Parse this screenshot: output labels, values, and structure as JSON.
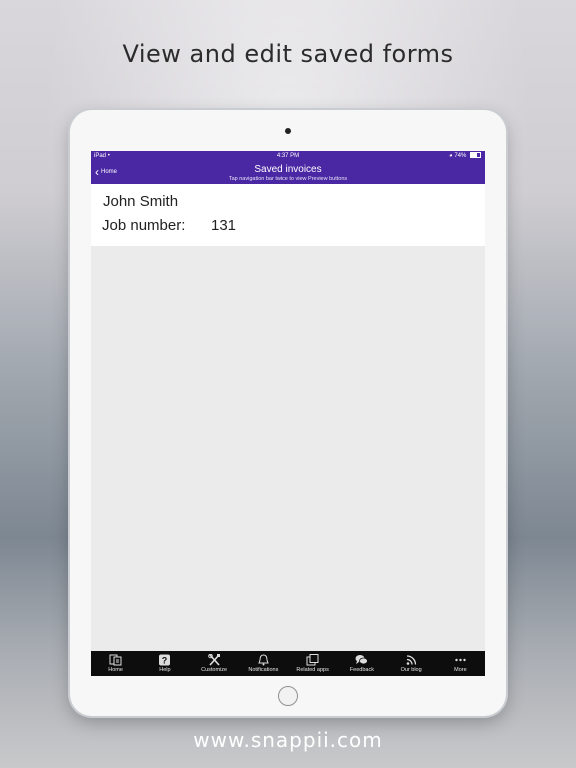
{
  "headline": "View and edit saved forms",
  "footer_url": "www.snappii.com",
  "status": {
    "device": "iPad",
    "time": "4:37 PM",
    "battery": "74%"
  },
  "nav": {
    "back_label": "Home",
    "title": "Saved invoices",
    "subtitle": "Tap navigation bar twice to view Preview buttons"
  },
  "record": {
    "name": "John Smith",
    "job_label": "Job number:",
    "job_value": "131"
  },
  "tabs": [
    {
      "label": "Home",
      "icon": "home-forms-icon"
    },
    {
      "label": "Help",
      "icon": "help-icon"
    },
    {
      "label": "Customize",
      "icon": "tools-icon"
    },
    {
      "label": "Notifications",
      "icon": "bell-icon"
    },
    {
      "label": "Related apps",
      "icon": "related-apps-icon"
    },
    {
      "label": "Feedback",
      "icon": "chat-bubbles-icon"
    },
    {
      "label": "Our blog",
      "icon": "rss-icon"
    },
    {
      "label": "More",
      "icon": "more-dots-icon"
    }
  ],
  "colors": {
    "nav_bar": "#4a27a3",
    "tab_bar": "#0d0d0d",
    "content_bg": "#ebebeb"
  }
}
